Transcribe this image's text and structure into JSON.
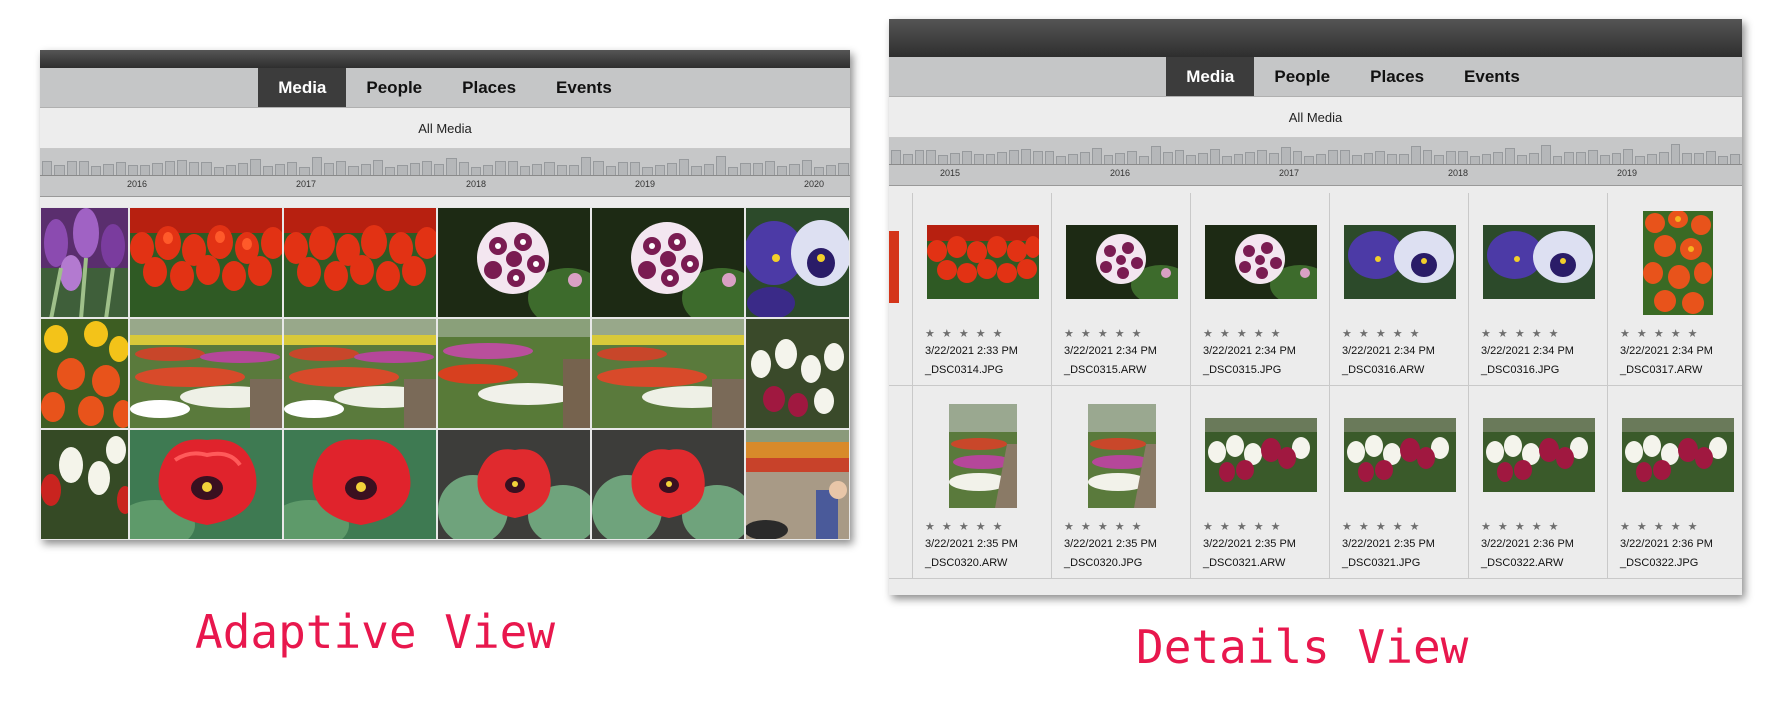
{
  "adaptive": {
    "tabs": [
      {
        "label": "Media",
        "active": true
      },
      {
        "label": "People",
        "active": false
      },
      {
        "label": "Places",
        "active": false
      },
      {
        "label": "Events",
        "active": false
      }
    ],
    "subtitle": "All Media",
    "years": [
      "2016",
      "2017",
      "2018",
      "2019",
      "2020"
    ],
    "caption": "Adaptive View"
  },
  "details": {
    "tabs": [
      {
        "label": "Media",
        "active": true
      },
      {
        "label": "People",
        "active": false
      },
      {
        "label": "Places",
        "active": false
      },
      {
        "label": "Events",
        "active": false
      }
    ],
    "subtitle": "All Media",
    "years": [
      "2015",
      "2016",
      "2017",
      "2018",
      "2019"
    ],
    "stars": "★ ★ ★ ★ ★",
    "row1": [
      {
        "date": "3/22/2021 2:33 PM",
        "file": "_DSC0314.JPG",
        "photo": "red-tulips"
      },
      {
        "date": "3/22/2021 2:34 PM",
        "file": "_DSC0315.ARW",
        "photo": "dianthus"
      },
      {
        "date": "3/22/2021 2:34 PM",
        "file": "_DSC0315.JPG",
        "photo": "dianthus"
      },
      {
        "date": "3/22/2021 2:34 PM",
        "file": "_DSC0316.ARW",
        "photo": "pansy"
      },
      {
        "date": "3/22/2021 2:34 PM",
        "file": "_DSC0316.JPG",
        "photo": "pansy"
      },
      {
        "date": "3/22/2021 2:34 PM",
        "file": "_DSC0317.ARW",
        "photo": "orange-tulips"
      }
    ],
    "row2": [
      {
        "date": "3/22/2021 2:35 PM",
        "file": "_DSC0320.ARW",
        "photo": "garden-path"
      },
      {
        "date": "3/22/2021 2:35 PM",
        "file": "_DSC0320.JPG",
        "photo": "garden-path"
      },
      {
        "date": "3/22/2021 2:35 PM",
        "file": "_DSC0321.ARW",
        "photo": "white-magenta-tulips"
      },
      {
        "date": "3/22/2021 2:35 PM",
        "file": "_DSC0321.JPG",
        "photo": "white-magenta-tulips"
      },
      {
        "date": "3/22/2021 2:36 PM",
        "file": "_DSC0322.ARW",
        "photo": "white-magenta-tulips"
      },
      {
        "date": "3/22/2021 2:36 PM",
        "file": "_DSC0322.JPG",
        "photo": "white-magenta-tulips"
      }
    ],
    "caption": "Details View"
  }
}
